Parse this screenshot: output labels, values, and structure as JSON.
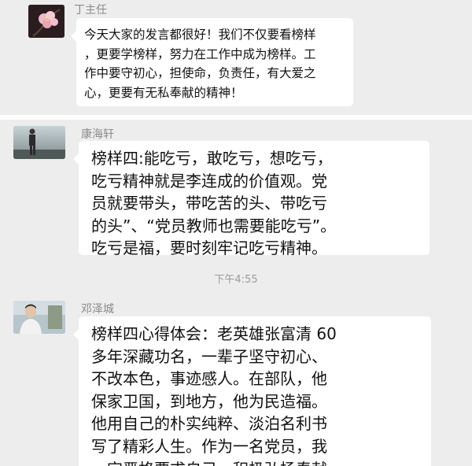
{
  "messages": [
    {
      "sender": "丁主任",
      "avatar": "flower-avatar",
      "lines": [
        "今天大家的发言都很好！我们不仅要看榜样",
        "，更要学榜样，努力在工作中成为榜样。工",
        "作中要守初心，担使命，负责任，有大爱之",
        "心，更要有无私奉献的精神！"
      ]
    },
    {
      "sender": "康海轩",
      "avatar": "person-standing-avatar",
      "lines": [
        "榜样四:能吃亏，敢吃亏，想吃亏，",
        "吃亏精神就是李连成的价值观。党",
        "员就要带头，带吃苦的头、带吃亏",
        "的头”、“党员教师也需要能吃亏”。",
        "吃亏是福，要时刻牢记吃亏精神。"
      ]
    },
    {
      "sender": "邓泽城",
      "avatar": "person-portrait-avatar",
      "lines": [
        "榜样四心得体会：老英雄张富清 60",
        "多年深藏功名，一辈子坚守初心、",
        "不改本色，事迹感人。在部队，他",
        "保家卫国，到地方，他为民造福。",
        "他用自己的朴实纯粹、淡泊名利书",
        "写了精彩人生。作为一名党员，我",
        "一定严格要求自己，积极弘扬奉献"
      ]
    }
  ],
  "timestamp": "下午4:55"
}
